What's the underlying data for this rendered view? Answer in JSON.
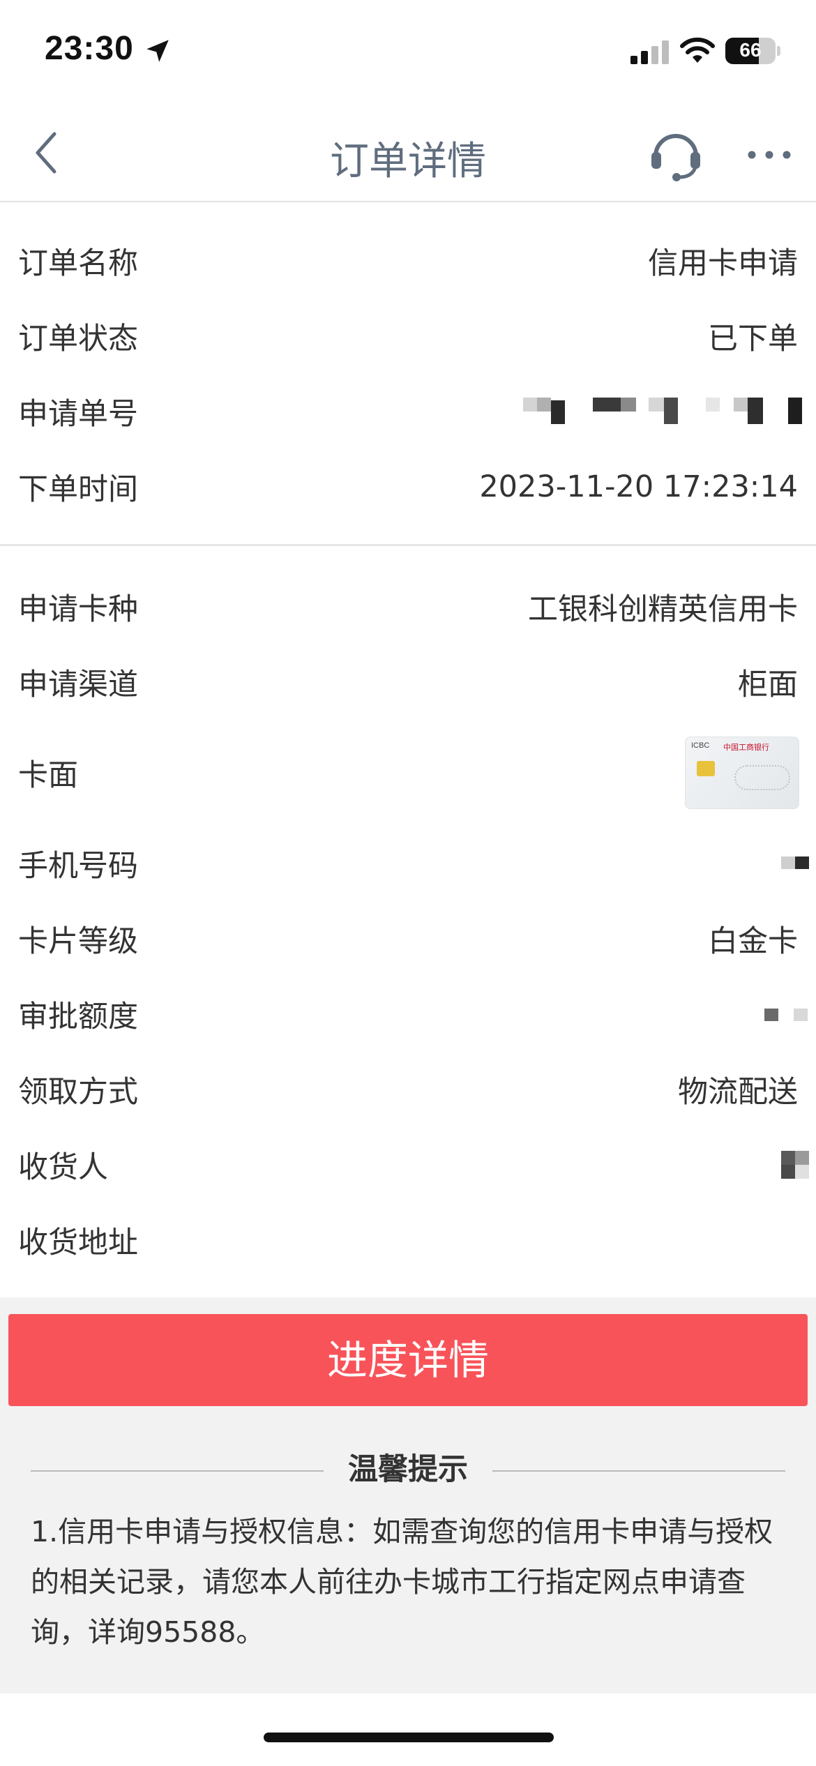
{
  "status_bar": {
    "time": "23:30",
    "battery_percent": "66",
    "battery_level": 0.66
  },
  "nav": {
    "title": "订单详情",
    "back_icon": "chevron-left-icon",
    "service_icon": "headset-icon",
    "more_icon": "more-dots-icon"
  },
  "order": {
    "name_label": "订单名称",
    "name_value": "信用卡申请",
    "status_label": "订单状态",
    "status_value": "已下单",
    "number_label": "申请单号",
    "time_label": "下单时间",
    "time_value": "2023-11-20 17:23:14"
  },
  "details": {
    "card_type_label": "申请卡种",
    "card_type_value": "工银科创精英信用卡",
    "channel_label": "申请渠道",
    "channel_value": "柜面",
    "card_face_label": "卡面",
    "phone_label": "手机号码",
    "level_label": "卡片等级",
    "level_value": "白金卡",
    "limit_label": "审批额度",
    "pickup_label": "领取方式",
    "pickup_value": "物流配送",
    "recipient_label": "收货人",
    "address_label": "收货地址"
  },
  "card_face": {
    "brand_en": "ICBC",
    "brand_cn": "中国工商银行"
  },
  "actions": {
    "progress_button": "进度详情"
  },
  "tips": {
    "title": "温馨提示",
    "body": "1.信用卡申请与授权信息：如需查询您的信用卡申请与授权的相关记录，请您本人前往办卡城市工行指定网点申请查询，详询95588。"
  },
  "colors": {
    "accent_button": "#f85359",
    "nav_title": "#5f6d7e",
    "divider": "#e6e6e6"
  }
}
